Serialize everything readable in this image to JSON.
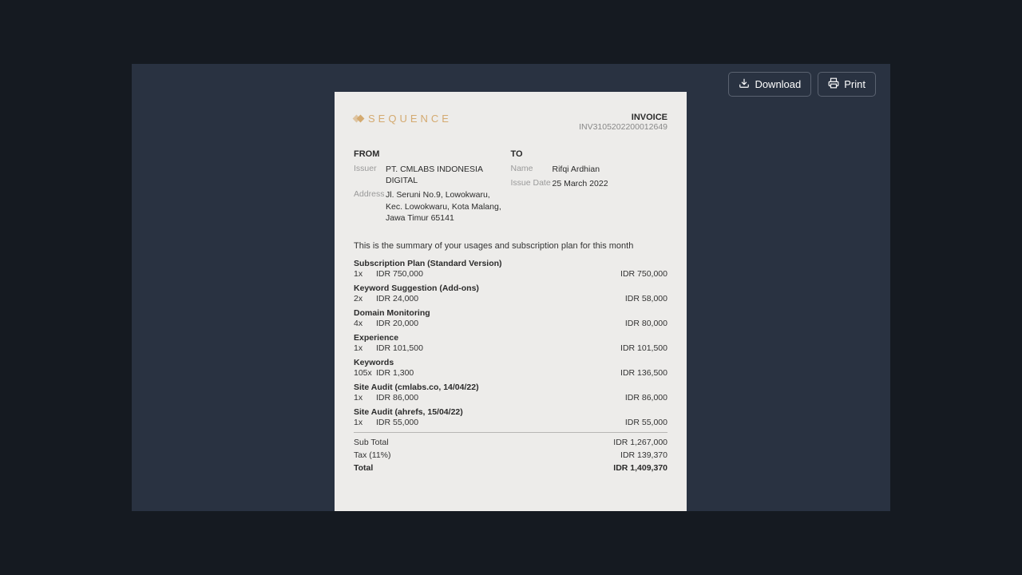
{
  "toolbar": {
    "download": "Download",
    "print": "Print"
  },
  "logo_text": "SEQUENCE",
  "invoice": {
    "title": "INVOICE",
    "number": "INV3105202200012649"
  },
  "from": {
    "heading": "FROM",
    "issuer_label": "Issuer",
    "issuer": "PT. CMLABS INDONESIA DIGITAL",
    "address_label": "Address",
    "address": "Jl. Seruni No.9, Lowokwaru, Kec. Lowokwaru, Kota Malang, Jawa Timur 65141"
  },
  "to": {
    "heading": "TO",
    "name_label": "Name",
    "name": "Rifqi Ardhian",
    "issue_date_label": "Issue Date",
    "issue_date": "25 March 2022"
  },
  "intro": "This is the summary of your usages and subscription plan for this month",
  "items": [
    {
      "name": "Subscription Plan (Standard Version)",
      "qty": "1x",
      "unit": "IDR 750,000",
      "total": "IDR 750,000"
    },
    {
      "name": "Keyword Suggestion (Add-ons)",
      "qty": "2x",
      "unit": "IDR 24,000",
      "total": "IDR 58,000"
    },
    {
      "name": "Domain Monitoring",
      "qty": "4x",
      "unit": "IDR 20,000",
      "total": "IDR 80,000"
    },
    {
      "name": "Experience",
      "qty": "1x",
      "unit": "IDR 101,500",
      "total": "IDR 101,500"
    },
    {
      "name": "Keywords",
      "qty": "105x",
      "unit": "IDR 1,300",
      "total": "IDR 136,500"
    },
    {
      "name": "Site Audit (cmlabs.co, 14/04/22)",
      "qty": "1x",
      "unit": "IDR 86,000",
      "total": "IDR 86,000"
    },
    {
      "name": "Site Audit (ahrefs, 15/04/22)",
      "qty": "1x",
      "unit": "IDR 55,000",
      "total": "IDR 55,000"
    }
  ],
  "totals": {
    "subtotal_label": "Sub Total",
    "subtotal": "IDR 1,267,000",
    "tax_label": "Tax (11%)",
    "tax": "IDR 139,370",
    "total_label": "Total",
    "total": "IDR 1,409,370"
  }
}
